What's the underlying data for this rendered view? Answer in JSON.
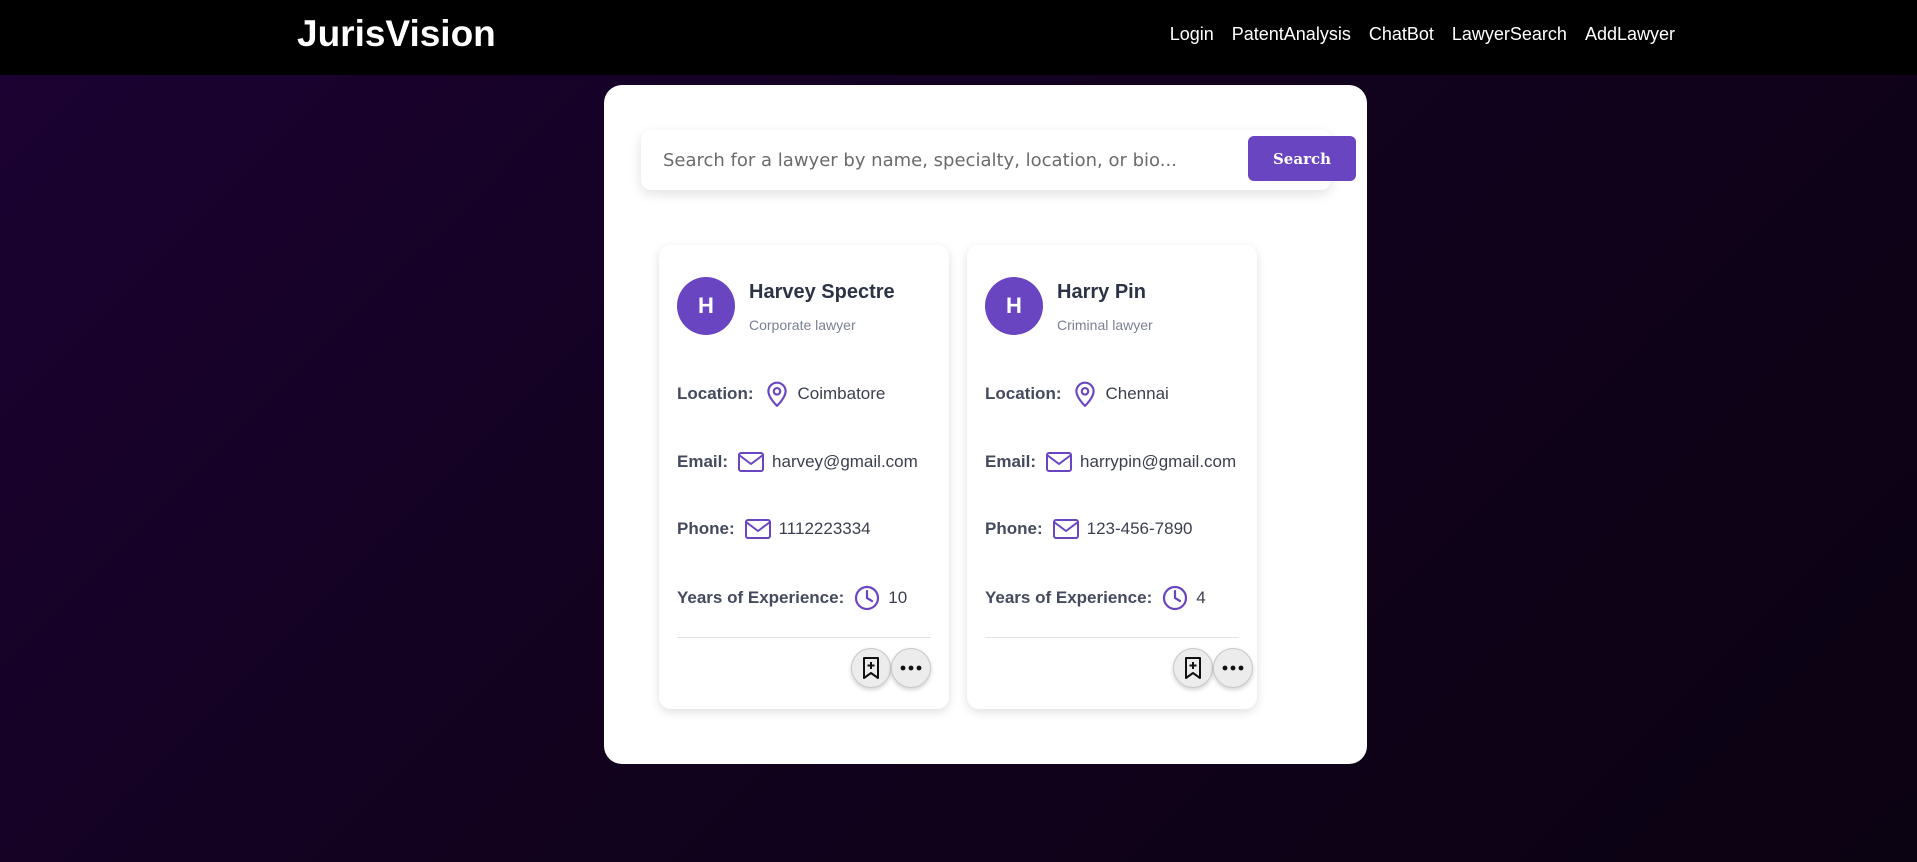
{
  "navbar": {
    "brand": "JurisVision",
    "links": [
      "Login",
      "PatentAnalysis",
      "ChatBot",
      "LawyerSearch",
      "AddLawyer"
    ]
  },
  "search": {
    "placeholder": "Search for a lawyer by name, specialty, location, or bio...",
    "value": "",
    "button_label": "Search"
  },
  "labels": {
    "location": "Location:",
    "email": "Email:",
    "phone": "Phone:",
    "experience": "Years of Experience:"
  },
  "lawyers": [
    {
      "initial": "H",
      "name": "Harvey Spectre",
      "specialty": "Corporate lawyer",
      "location": "Coimbatore",
      "email": "harvey@gmail.com",
      "phone": "1112223334",
      "experience": "10"
    },
    {
      "initial": "H",
      "name": "Harry Pin",
      "specialty": "Criminal lawyer",
      "location": "Chennai",
      "email": "harrypin@gmail.com",
      "phone": "123-456-7890",
      "experience": "4"
    }
  ],
  "icons": {
    "location": "map-pin-icon",
    "email": "mail-icon",
    "phone": "mail-icon",
    "experience": "clock-icon",
    "bookmark": "bookmark-plus-icon",
    "more": "more-horizontal-icon"
  },
  "colors": {
    "accent": "#6a45c2",
    "navbar": "#000000",
    "background": "#1c0233"
  }
}
